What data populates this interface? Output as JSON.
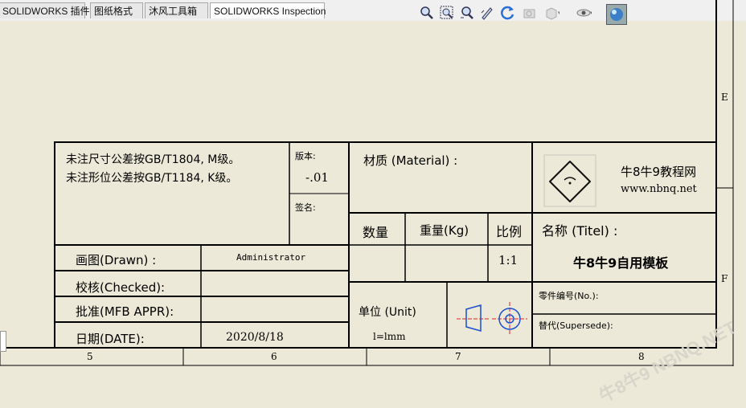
{
  "tabs": [
    {
      "label": "SOLIDWORKS 插件",
      "active": false
    },
    {
      "label": "图纸格式",
      "active": false
    },
    {
      "label": "沐风工具箱",
      "active": false
    },
    {
      "label": "SOLIDWORKS Inspection",
      "active": true
    }
  ],
  "toolbar_icons": [
    "zoom-to-fit-icon",
    "zoom-to-area-icon",
    "zoom-in-out-icon",
    "pan-icon",
    "rotate-icon",
    "previous-view-icon",
    "display-style-icon",
    "hide-show-icon",
    "appearance-icon"
  ],
  "title_block": {
    "tolerance_line1": "未注尺寸公差按GB/T1804, M级。",
    "tolerance_line2": "未注形位公差按GB/T1184, K级。",
    "version_label": "版本:",
    "version_value": "-.01",
    "sign_label": "签名:",
    "material_label": "材质 (Material) :",
    "company_name": "牛8牛9教程网",
    "company_url": "www.nbnq.net",
    "qty_label": "数量",
    "weight_label": "重量(Kg)",
    "scale_label": "比例",
    "scale_value": "1:1",
    "title_label": "名称 (Titel) :",
    "title_value": "牛8牛9自用模板",
    "drawn_label": "画图(Drawn) :",
    "drawn_value": "Administrator",
    "checked_label": "校核(Checked):",
    "appr_label": "批准(MFB APPR):",
    "date_label": "日期(DATE):",
    "date_value": "2020/8/18",
    "unit_label": "单位 (Unit)",
    "unit_value": "l=lmm",
    "part_no_label": "零件编号(No.):",
    "supersede_label": "替代(Supersede):"
  },
  "border": {
    "zone_numbers": [
      "5",
      "6",
      "7",
      "8"
    ],
    "zone_letters": [
      "E",
      "F"
    ]
  },
  "watermark": "牛8牛9 NBNQ.NET"
}
